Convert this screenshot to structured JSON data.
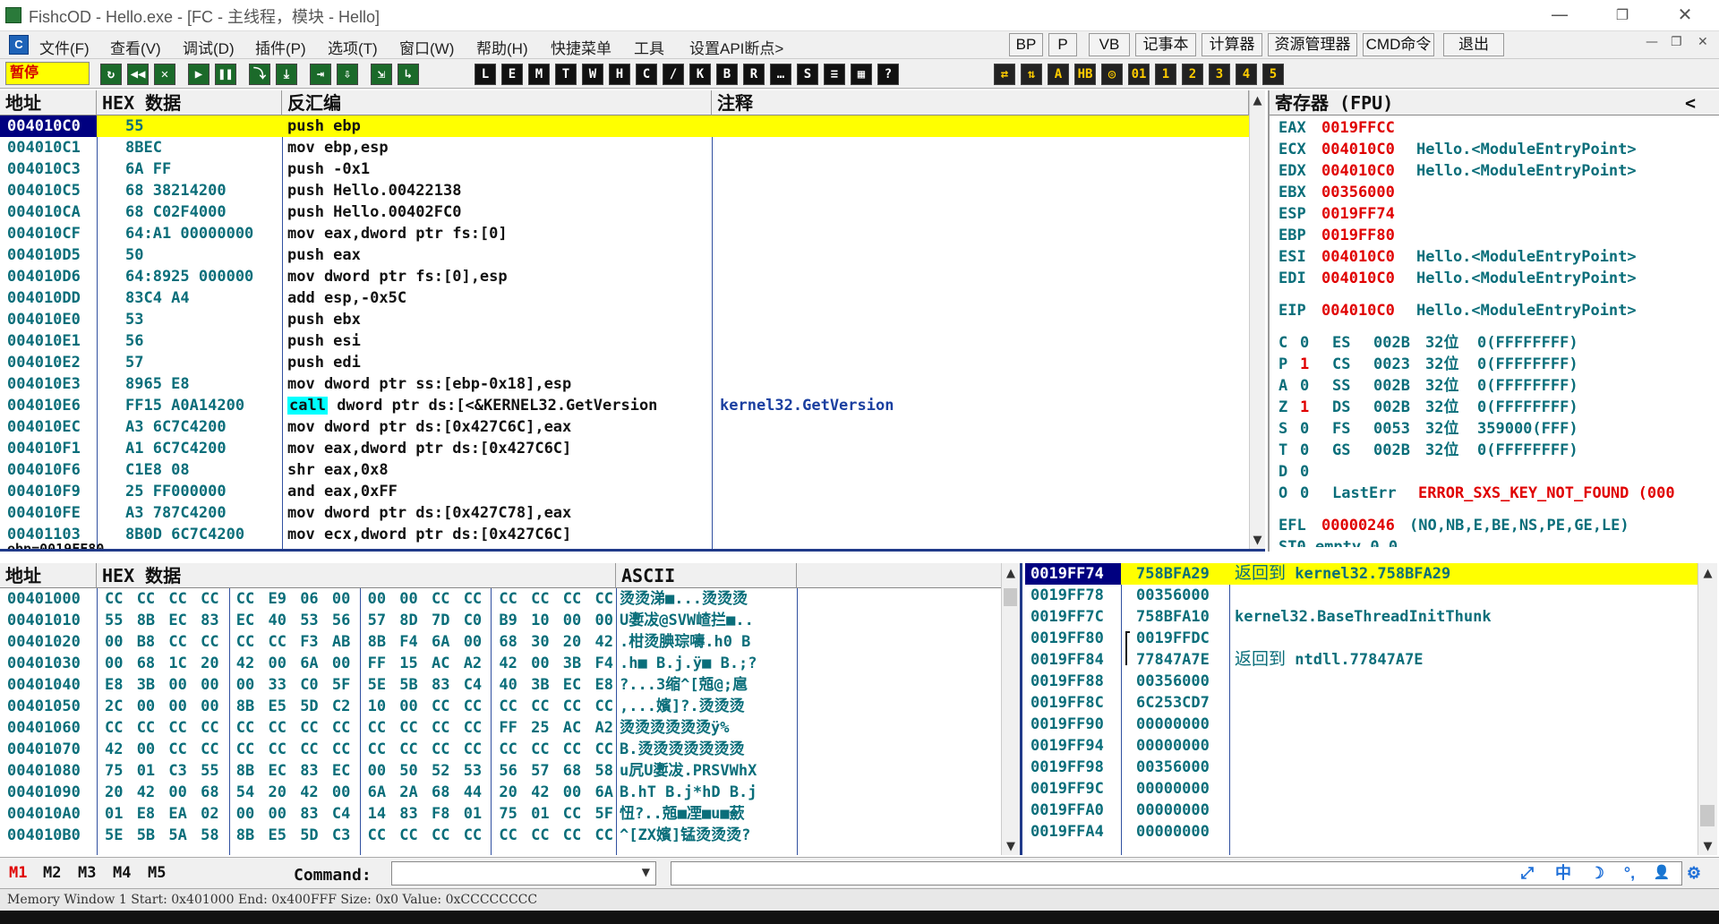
{
  "window": {
    "title": "FishcOD - Hello.exe - [FC - 主线程，模块 - Hello]",
    "minimize": "—",
    "restore": "❐",
    "close": "✕"
  },
  "menu": {
    "icon": "C",
    "items": [
      "文件(F)",
      "查看(V)",
      "调试(D)",
      "插件(P)",
      "选项(T)",
      "窗口(W)",
      "帮助(H)",
      "快捷菜单",
      "工具",
      "设置API断点>"
    ],
    "quick_buttons": [
      "BP",
      "P",
      "VB",
      "记事本",
      "计算器",
      "资源管理器",
      "CMD命令",
      "退出"
    ],
    "mdi_controls": [
      "—",
      "❐",
      "✕"
    ]
  },
  "toolbar": {
    "status": "暂停",
    "buttons_a": [
      "↻",
      "◀◀",
      "✕",
      "▶",
      "❚❚",
      "⤵",
      "⤓",
      "⇥",
      "⇩",
      "⇲",
      "↳"
    ],
    "buttons_b": [
      "L",
      "E",
      "M",
      "T",
      "W",
      "H",
      "C",
      "/",
      "K",
      "B",
      "R",
      "…",
      "S",
      "≡",
      "▦",
      "?"
    ],
    "buttons_c": [
      "⇄",
      "⇅",
      "A",
      "HB",
      "◎",
      "01",
      "1",
      "2",
      "3",
      "4",
      "5"
    ]
  },
  "cpu": {
    "headers": {
      "addr": "地址",
      "hex": "HEX 数据",
      "disasm": "反汇编",
      "comment": "注释"
    },
    "rows": [
      {
        "addr": "004010C0",
        "hex": "55",
        "disasm": "push ebp",
        "comment": ""
      },
      {
        "addr": "004010C1",
        "hex": "8BEC",
        "disasm": "mov ebp,esp",
        "comment": ""
      },
      {
        "addr": "004010C3",
        "hex": "6A FF",
        "disasm": "push -0x1",
        "comment": ""
      },
      {
        "addr": "004010C5",
        "hex": "68 38214200",
        "disasm": "push Hello.00422138",
        "comment": ""
      },
      {
        "addr": "004010CA",
        "hex": "68 C02F4000",
        "disasm": "push Hello.00402FC0",
        "comment": ""
      },
      {
        "addr": "004010CF",
        "hex": "64:A1 00000000",
        "disasm": "mov eax,dword ptr fs:[0]",
        "comment": ""
      },
      {
        "addr": "004010D5",
        "hex": "50",
        "disasm": "push eax",
        "comment": ""
      },
      {
        "addr": "004010D6",
        "hex": "64:8925 000000",
        "disasm": "mov dword ptr fs:[0],esp",
        "comment": ""
      },
      {
        "addr": "004010DD",
        "hex": "83C4 A4",
        "disasm": "add esp,-0x5C",
        "comment": ""
      },
      {
        "addr": "004010E0",
        "hex": "53",
        "disasm": "push ebx",
        "comment": ""
      },
      {
        "addr": "004010E1",
        "hex": "56",
        "disasm": "push esi",
        "comment": ""
      },
      {
        "addr": "004010E2",
        "hex": "57",
        "disasm": "push edi",
        "comment": ""
      },
      {
        "addr": "004010E3",
        "hex": "8965 E8",
        "disasm": "mov dword ptr ss:[ebp-0x18],esp",
        "comment": ""
      },
      {
        "addr": "004010E6",
        "hex": "FF15 A0A14200",
        "disasm_kw": "call",
        "disasm": " dword ptr ds:[<&KERNEL32.GetVersion",
        "comment": "kernel32.GetVersion"
      },
      {
        "addr": "004010EC",
        "hex": "A3 6C7C4200",
        "disasm": "mov dword ptr ds:[0x427C6C],eax",
        "comment": ""
      },
      {
        "addr": "004010F1",
        "hex": "A1 6C7C4200",
        "disasm": "mov eax,dword ptr ds:[0x427C6C]",
        "comment": ""
      },
      {
        "addr": "004010F6",
        "hex": "C1E8 08",
        "disasm": "shr eax,0x8",
        "comment": ""
      },
      {
        "addr": "004010F9",
        "hex": "25 FF000000",
        "disasm": "and eax,0xFF",
        "comment": ""
      },
      {
        "addr": "004010FE",
        "hex": "A3 787C4200",
        "disasm": "mov dword ptr ds:[0x427C78],eax",
        "comment": ""
      },
      {
        "addr": "00401103",
        "hex": "8B0D 6C7C4200",
        "disasm": "mov ecx,dword ptr ds:[0x427C6C]",
        "comment": ""
      }
    ],
    "info_line": "ebp=0019FF80"
  },
  "registers": {
    "title": "寄存器 (FPU)",
    "collapse": "<",
    "regs": [
      {
        "name": "EAX",
        "value": "0019FFCC",
        "note": ""
      },
      {
        "name": "ECX",
        "value": "004010C0",
        "note": "Hello.<ModuleEntryPoint>"
      },
      {
        "name": "EDX",
        "value": "004010C0",
        "note": "Hello.<ModuleEntryPoint>"
      },
      {
        "name": "EBX",
        "value": "00356000",
        "note": ""
      },
      {
        "name": "ESP",
        "value": "0019FF74",
        "note": ""
      },
      {
        "name": "EBP",
        "value": "0019FF80",
        "note": ""
      },
      {
        "name": "ESI",
        "value": "004010C0",
        "note": "Hello.<ModuleEntryPoint>"
      },
      {
        "name": "EDI",
        "value": "004010C0",
        "note": "Hello.<ModuleEntryPoint>"
      }
    ],
    "eip": {
      "name": "EIP",
      "value": "004010C0",
      "note": "Hello.<ModuleEntryPoint>"
    },
    "flags": [
      {
        "f": "C",
        "v": "0",
        "seg": "ES",
        "sel": "002B",
        "bits": "32位",
        "range": "0(FFFFFFFF)"
      },
      {
        "f": "P",
        "v": "1",
        "seg": "CS",
        "sel": "0023",
        "bits": "32位",
        "range": "0(FFFFFFFF)"
      },
      {
        "f": "A",
        "v": "0",
        "seg": "SS",
        "sel": "002B",
        "bits": "32位",
        "range": "0(FFFFFFFF)"
      },
      {
        "f": "Z",
        "v": "1",
        "seg": "DS",
        "sel": "002B",
        "bits": "32位",
        "range": "0(FFFFFFFF)"
      },
      {
        "f": "S",
        "v": "0",
        "seg": "FS",
        "sel": "0053",
        "bits": "32位",
        "range": "359000(FFF)"
      },
      {
        "f": "T",
        "v": "0",
        "seg": "GS",
        "sel": "002B",
        "bits": "32位",
        "range": "0(FFFFFFFF)"
      },
      {
        "f": "D",
        "v": "0",
        "seg": "",
        "sel": "",
        "bits": "",
        "range": ""
      },
      {
        "f": "O",
        "v": "0",
        "seg": "",
        "sel": "",
        "bits": "",
        "range": ""
      }
    ],
    "lasterr_label": "LastErr",
    "lasterr_value": "ERROR_SXS_KEY_NOT_FOUND (000",
    "efl_label": "EFL",
    "efl_value": "00000246",
    "efl_flags": "(NO,NB,E,BE,NS,PE,GE,LE)",
    "st0": "ST0 empty 0.0"
  },
  "dump": {
    "headers": {
      "addr": "地址",
      "hex": "HEX 数据",
      "ascii": "ASCII"
    },
    "rows": [
      {
        "addr": "00401000",
        "bytes": [
          "CC",
          "CC",
          "CC",
          "CC",
          "CC",
          "E9",
          "06",
          "00",
          "00",
          "00",
          "CC",
          "CC",
          "CC",
          "CC",
          "CC",
          "CC"
        ],
        "ascii": "烫烫涕■...烫烫烫"
      },
      {
        "addr": "00401010",
        "bytes": [
          "55",
          "8B",
          "EC",
          "83",
          "EC",
          "40",
          "53",
          "56",
          "57",
          "8D",
          "7D",
          "C0",
          "B9",
          "10",
          "00",
          "00"
        ],
        "ascii": "U嬱冹@SVW嵖拦■.."
      },
      {
        "addr": "00401020",
        "bytes": [
          "00",
          "B8",
          "CC",
          "CC",
          "CC",
          "CC",
          "F3",
          "AB",
          "8B",
          "F4",
          "6A",
          "00",
          "68",
          "30",
          "20",
          "42"
        ],
        "ascii": ".柑烫腆琮嚋.h0 B"
      },
      {
        "addr": "00401030",
        "bytes": [
          "00",
          "68",
          "1C",
          "20",
          "42",
          "00",
          "6A",
          "00",
          "FF",
          "15",
          "AC",
          "A2",
          "42",
          "00",
          "3B",
          "F4"
        ],
        "ascii": ".h■ B.j.ÿ■  B.;?"
      },
      {
        "addr": "00401040",
        "bytes": [
          "E8",
          "3B",
          "00",
          "00",
          "00",
          "33",
          "C0",
          "5F",
          "5E",
          "5B",
          "83",
          "C4",
          "40",
          "3B",
          "EC",
          "E8"
        ],
        "ascii": "?...3缩^[兡@;扈"
      },
      {
        "addr": "00401050",
        "bytes": [
          "2C",
          "00",
          "00",
          "00",
          "8B",
          "E5",
          "5D",
          "C2",
          "10",
          "00",
          "CC",
          "CC",
          "CC",
          "CC",
          "CC",
          "CC"
        ],
        "ascii": ",...嬪]?.烫烫烫"
      },
      {
        "addr": "00401060",
        "bytes": [
          "CC",
          "CC",
          "CC",
          "CC",
          "CC",
          "CC",
          "CC",
          "CC",
          "CC",
          "CC",
          "CC",
          "CC",
          "FF",
          "25",
          "AC",
          "A2"
        ],
        "ascii": "烫烫烫烫烫烫ÿ%"
      },
      {
        "addr": "00401070",
        "bytes": [
          "42",
          "00",
          "CC",
          "CC",
          "CC",
          "CC",
          "CC",
          "CC",
          "CC",
          "CC",
          "CC",
          "CC",
          "CC",
          "CC",
          "CC",
          "CC"
        ],
        "ascii": "B.烫烫烫烫烫烫烫"
      },
      {
        "addr": "00401080",
        "bytes": [
          "75",
          "01",
          "C3",
          "55",
          "8B",
          "EC",
          "83",
          "EC",
          "00",
          "50",
          "52",
          "53",
          "56",
          "57",
          "68",
          "58"
        ],
        "ascii": "u凥U嬱冹.PRSVWhX"
      },
      {
        "addr": "00401090",
        "bytes": [
          "20",
          "42",
          "00",
          "68",
          "54",
          "20",
          "42",
          "00",
          "6A",
          "2A",
          "68",
          "44",
          "20",
          "42",
          "00",
          "6A"
        ],
        "ascii": " B.hT B.j*hD B.j"
      },
      {
        "addr": "004010A0",
        "bytes": [
          "01",
          "E8",
          "EA",
          "02",
          "00",
          "00",
          "83",
          "C4",
          "14",
          "83",
          "F8",
          "01",
          "75",
          "01",
          "CC",
          "5F"
        ],
        "ascii": "忸?..兡■凐■u■蘝"
      },
      {
        "addr": "004010B0",
        "bytes": [
          "5E",
          "5B",
          "5A",
          "58",
          "8B",
          "E5",
          "5D",
          "C3",
          "CC",
          "CC",
          "CC",
          "CC",
          "CC",
          "CC",
          "CC",
          "CC"
        ],
        "ascii": "^[ZX嬪]锰烫烫烫?"
      }
    ]
  },
  "stack": {
    "rows": [
      {
        "addr": "0019FF74",
        "value": "758BFA29",
        "comment_kw": "返回到",
        "comment": " kernel32.758BFA29"
      },
      {
        "addr": "0019FF78",
        "value": "00356000",
        "comment_kw": "",
        "comment": ""
      },
      {
        "addr": "0019FF7C",
        "value": "758BFA10",
        "comment_kw": "",
        "comment": "kernel32.BaseThreadInitThunk"
      },
      {
        "addr": "0019FF80",
        "value": "0019FFDC",
        "comment_kw": "",
        "comment": ""
      },
      {
        "addr": "0019FF84",
        "value": "77847A7E",
        "comment_kw": "返回到",
        "comment": " ntdll.77847A7E"
      },
      {
        "addr": "0019FF88",
        "value": "00356000",
        "comment_kw": "",
        "comment": ""
      },
      {
        "addr": "0019FF8C",
        "value": "6C253CD7",
        "comment_kw": "",
        "comment": ""
      },
      {
        "addr": "0019FF90",
        "value": "00000000",
        "comment_kw": "",
        "comment": ""
      },
      {
        "addr": "0019FF94",
        "value": "00000000",
        "comment_kw": "",
        "comment": ""
      },
      {
        "addr": "0019FF98",
        "value": "00356000",
        "comment_kw": "",
        "comment": ""
      },
      {
        "addr": "0019FF9C",
        "value": "00000000",
        "comment_kw": "",
        "comment": ""
      },
      {
        "addr": "0019FFA0",
        "value": "00000000",
        "comment_kw": "",
        "comment": ""
      },
      {
        "addr": "0019FFA4",
        "value": "00000000",
        "comment_kw": "",
        "comment": ""
      }
    ]
  },
  "command": {
    "mbuttons": [
      "M1",
      "M2",
      "M3",
      "M4",
      "M5"
    ],
    "label": "Command:",
    "value": ""
  },
  "ime": [
    "⤢",
    "中",
    "☽",
    "°,",
    "👤",
    "⚙"
  ],
  "statusbar": "Memory Window 1  Start: 0x401000  End: 0x400FFF  Size: 0x0 Value: 0xCCCCCCCC",
  "colors": {
    "highlight": "#ffff00",
    "call_bg": "#00ffff",
    "teal": "#0a6e7a",
    "red": "#e00000",
    "selection": "#000080"
  }
}
